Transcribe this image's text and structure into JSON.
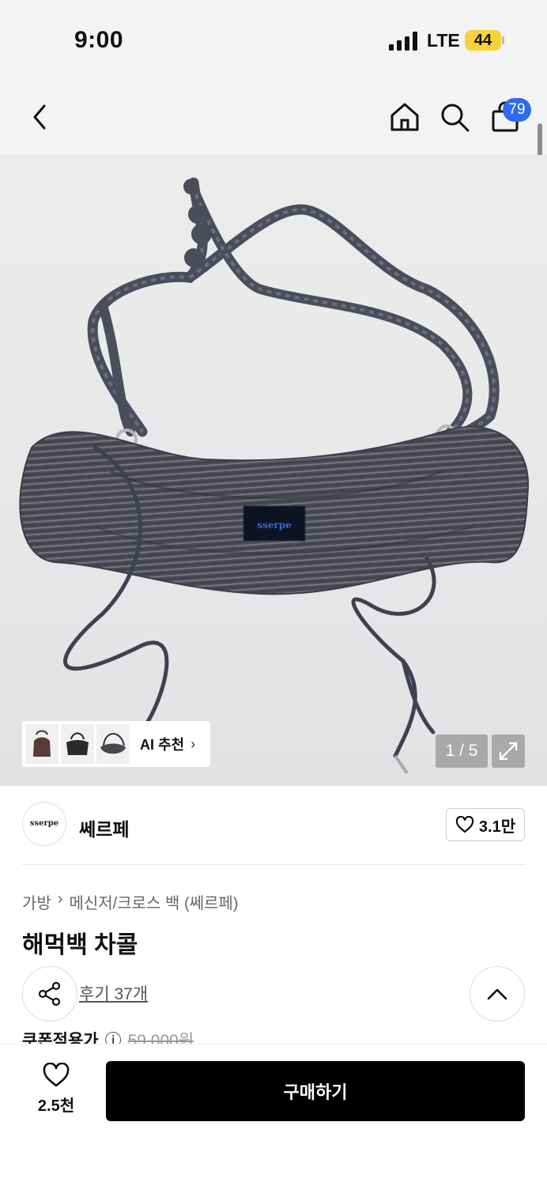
{
  "status_bar": {
    "time": "9:00",
    "network": "LTE",
    "battery": "44"
  },
  "nav": {
    "cart_count": "79",
    "icons": [
      "back-icon",
      "home-icon",
      "search-icon",
      "cart-icon"
    ]
  },
  "gallery": {
    "ai_label": "AI 추천",
    "counter": "1 / 5",
    "bag_label": "sserpe"
  },
  "brand": {
    "logo_text": "sserpe",
    "name": "쎄르페",
    "likes": "3.1만"
  },
  "breadcrumb": [
    "가방",
    "메신저/크로스 백 (쎄르페)"
  ],
  "product": {
    "title": "해먹백 차콜",
    "reviews": "후기 37개",
    "price_label": "쿠폰적용가",
    "original_price": "59,000원"
  },
  "bottom": {
    "wish_count": "2.5천",
    "buy_label": "구매하기"
  },
  "colors": {
    "badge": "#2f6bef",
    "buy": "#000000",
    "battery": "#f7d23a"
  }
}
